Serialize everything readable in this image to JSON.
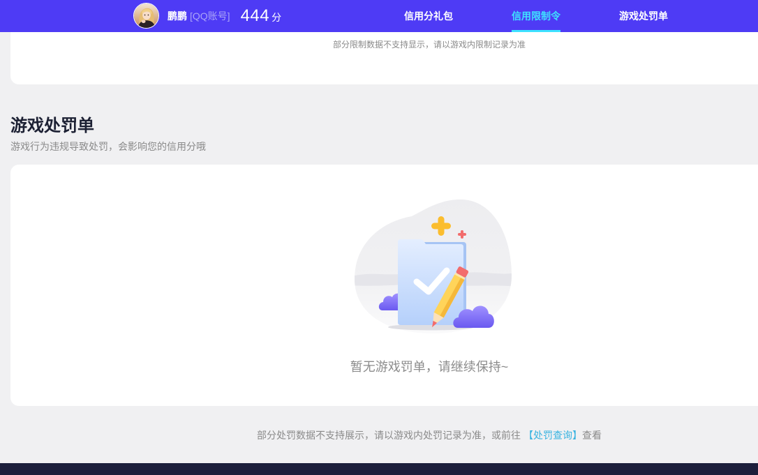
{
  "header": {
    "user": {
      "name": "鹏鹏",
      "account_type": "[QQ账号]",
      "score": "444",
      "score_unit": "分"
    },
    "nav": [
      {
        "label": "信用分礼包",
        "active": false
      },
      {
        "label": "信用限制令",
        "active": true
      },
      {
        "label": "游戏处罚单",
        "active": false
      }
    ]
  },
  "restriction_card": {
    "note": "部分限制数据不支持显示，请以游戏内限制记录为准"
  },
  "penalty_section": {
    "title": "游戏处罚单",
    "subtitle": "游戏行为违规导致处罚，会影响您的信用分哦",
    "empty_text": "暂无游戏罚单，请继续保持~"
  },
  "footer_note": {
    "text": "部分处罚数据不支持展示，请以游戏内处罚记录为准，或前往",
    "link_label": "【处罚查询】",
    "suffix": "查看"
  },
  "icons": {
    "avatar": "user-avatar",
    "empty_state": "empty-clipboard-check-illustration"
  },
  "colors": {
    "header_bg": "#4e3bf5",
    "active_nav": "#3ee2ff",
    "link": "#38b3e0",
    "page_bg": "#f0f0f2",
    "card_bg": "#ffffff",
    "title": "#1c2033",
    "footer_bg": "#1c1e3b"
  }
}
